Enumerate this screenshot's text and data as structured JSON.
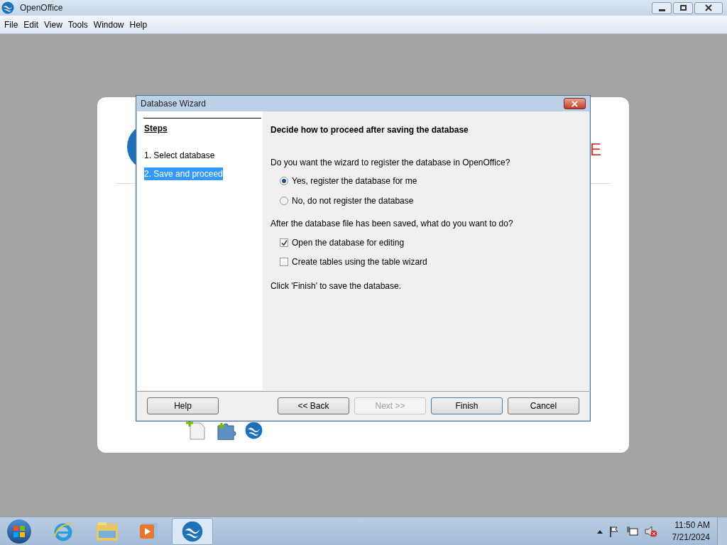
{
  "window": {
    "title": "OpenOffice"
  },
  "menu": [
    "File",
    "Edit",
    "View",
    "Tools",
    "Window",
    "Help"
  ],
  "start_center": {
    "logo_fragment": "E"
  },
  "dialog": {
    "title": "Database Wizard",
    "steps_heading": "Steps",
    "steps": [
      {
        "label": "1. Select database",
        "selected": false
      },
      {
        "label": "2. Save and proceed",
        "selected": true
      }
    ],
    "heading": "Decide how to proceed after saving the database",
    "question_register": "Do you want the wizard to register the database in OpenOffice?",
    "radios": [
      {
        "label": "Yes, register the database for me",
        "selected": true
      },
      {
        "label": "No, do not register the database",
        "selected": false
      }
    ],
    "question_after": "After the database file has been saved, what do you want to do?",
    "checkboxes": [
      {
        "label": "Open the database for editing",
        "checked": true
      },
      {
        "label": "Create tables using the table wizard",
        "checked": false
      }
    ],
    "note": "Click 'Finish' to save the database.",
    "buttons": [
      {
        "label": "Help",
        "disabled": false,
        "focused": false
      },
      {
        "label": "<< Back",
        "disabled": false,
        "focused": false
      },
      {
        "label": "Next >>",
        "disabled": true,
        "focused": false
      },
      {
        "label": "Finish",
        "disabled": false,
        "focused": true
      },
      {
        "label": "Cancel",
        "disabled": false,
        "focused": false
      }
    ]
  },
  "taskbar": {
    "time": "11:50 AM",
    "date": "7/21/2024"
  }
}
